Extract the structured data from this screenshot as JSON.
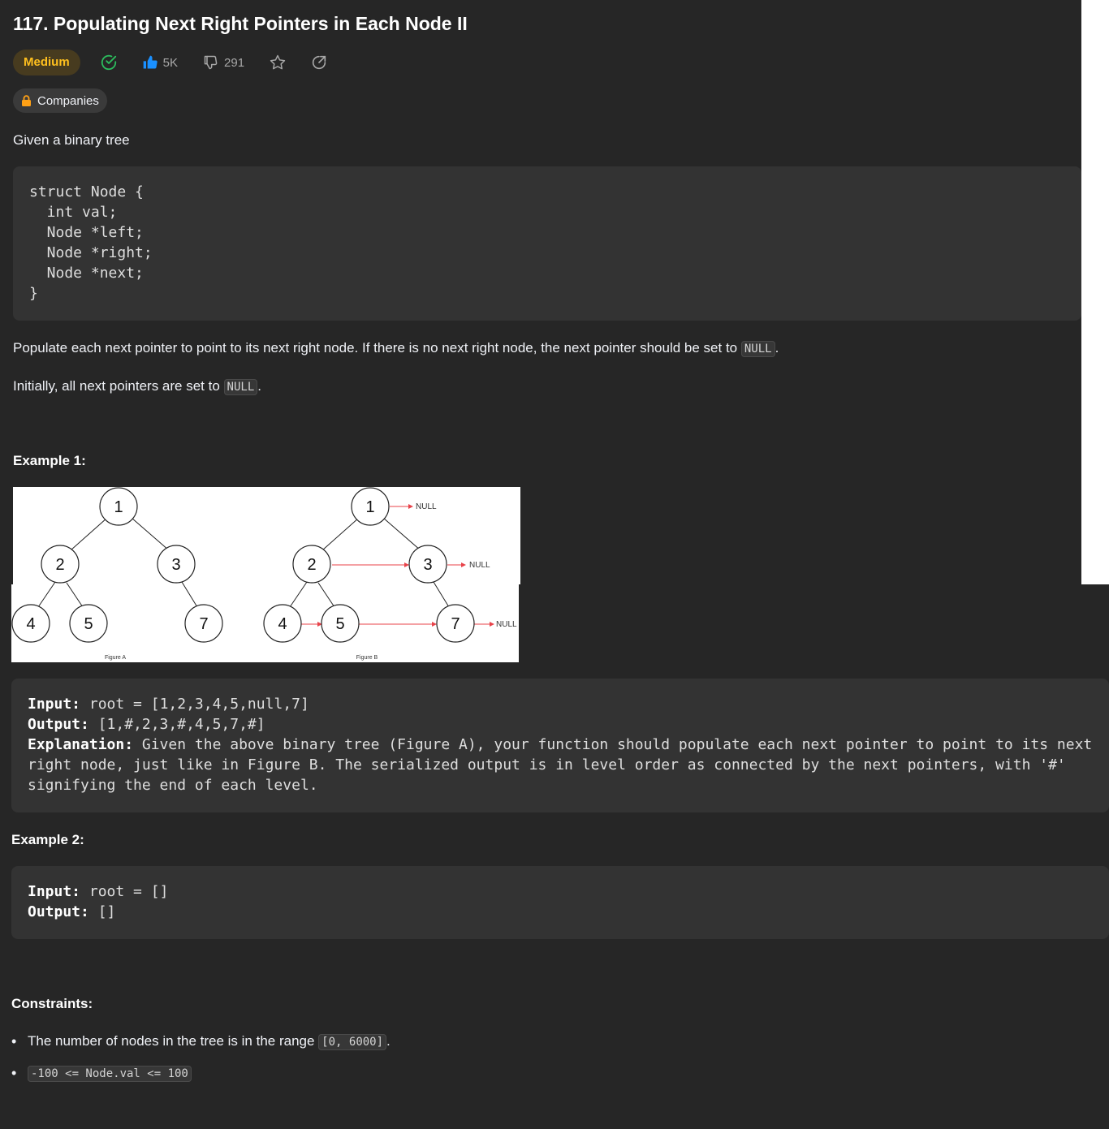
{
  "problem": {
    "title": "117. Populating Next Right Pointers in Each Node II",
    "difficulty": "Medium",
    "likes": "5K",
    "dislikes": "291",
    "companies_label": "Companies"
  },
  "description": {
    "intro": "Given a binary tree",
    "struct_code": "struct Node {\n  int val;\n  Node *left;\n  Node *right;\n  Node *next;\n}",
    "populate_text": "Populate each next pointer to point to its next right node. If there is no next right node, the next pointer should be set to ",
    "null_code": "NULL",
    "initially_text": "Initially, all next pointers are set to "
  },
  "example1": {
    "heading": "Example 1:",
    "figure": {
      "tree_a_nodes": [
        "1",
        "2",
        "3",
        "4",
        "5",
        "7"
      ],
      "tree_b_nodes": [
        "1",
        "2",
        "3",
        "4",
        "5",
        "7"
      ],
      "null_label": "NULL",
      "caption_a": "Figure A",
      "caption_b": "Figure B"
    },
    "input_label": "Input:",
    "input_value": " root = [1,2,3,4,5,null,7]",
    "output_label": "Output:",
    "output_value": " [1,#,2,3,#,4,5,7,#]",
    "explanation_label": "Explanation:",
    "explanation_value": " Given the above binary tree (Figure A), your function should populate each next pointer to point to its next\nright node, just like in Figure B. The serialized output is in level order as connected by the next pointers, with '#'\nsignifying the end of each level."
  },
  "example2": {
    "heading": "Example 2:",
    "input_label": "Input:",
    "input_value": " root = []",
    "output_label": "Output:",
    "output_value": " []"
  },
  "constraints": {
    "heading": "Constraints:",
    "item1_text": "The number of nodes in the tree is in the range ",
    "item1_code": "[0, 6000]",
    "item1_suffix": ".",
    "item2_code": "-100 <= Node.val <= 100"
  },
  "colors": {
    "background": "#262626",
    "medium": "#ffc01e",
    "solved": "#2cbb5d",
    "like": "#1a90ff",
    "arrow": "#e8434a"
  }
}
